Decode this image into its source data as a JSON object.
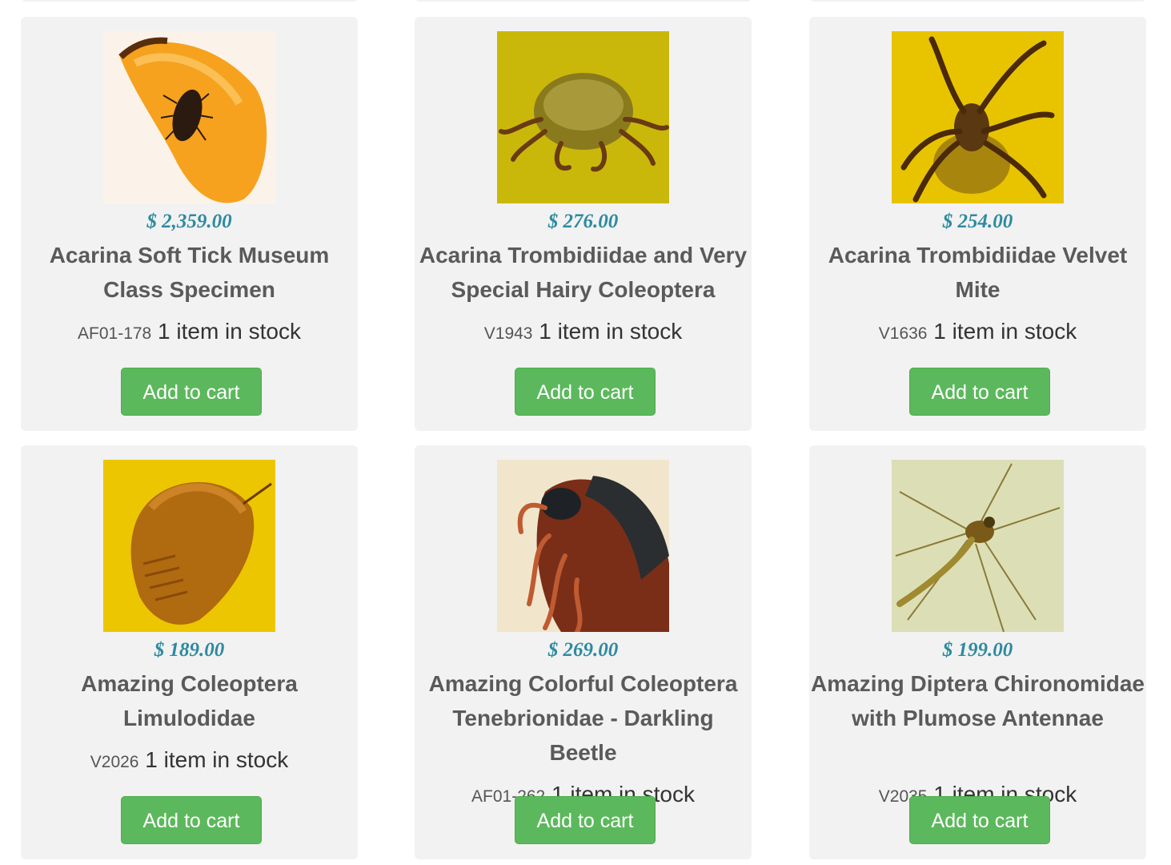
{
  "products": [
    {
      "price": "$ 2,359.00",
      "title": "Acarina Soft Tick Museum Class Specimen",
      "sku": "AF01-178",
      "stock": "1 item in stock",
      "button": "Add to cart",
      "image_icon": "amber-soft-tick-photo",
      "image_bg": "#f6e9d8"
    },
    {
      "price": "$ 276.00",
      "title": "Acarina Trombidiidae and Very Special Hairy Coleoptera",
      "sku": "V1943",
      "stock": "1 item in stock",
      "button": "Add to cart",
      "image_icon": "amber-mite-photo",
      "image_bg": "#c9b80a"
    },
    {
      "price": "$ 254.00",
      "title": "Acarina Trombidiidae Velvet Mite",
      "sku": "V1636",
      "stock": "1 item in stock",
      "button": "Add to cart",
      "image_icon": "amber-velvet-mite-photo",
      "image_bg": "#e8c400"
    },
    {
      "price": "$ 189.00",
      "title": "Amazing Coleoptera Limulodidae",
      "sku": "V2026",
      "stock": "1 item in stock",
      "button": "Add to cart",
      "image_icon": "amber-beetle-photo",
      "image_bg": "#e9c300"
    },
    {
      "price": "$ 269.00",
      "title": "Amazing Colorful Coleoptera Tenebrionidae - Darkling Beetle",
      "sku": "AF01-262",
      "stock": "1 item in stock",
      "button": "Add to cart",
      "image_icon": "amber-darkling-beetle-photo",
      "image_bg": "#efe3c8"
    },
    {
      "price": "$ 199.00",
      "title": "Amazing Diptera Chironomidae with Plumose Antennae",
      "sku": "V2035",
      "stock": "1 item in stock",
      "button": "Add to cart",
      "image_icon": "amber-midge-photo",
      "image_bg": "#d9dcb0"
    }
  ],
  "colors": {
    "price": "#2d8aa0",
    "button": "#5cb85c",
    "card": "#f2f2f2"
  }
}
